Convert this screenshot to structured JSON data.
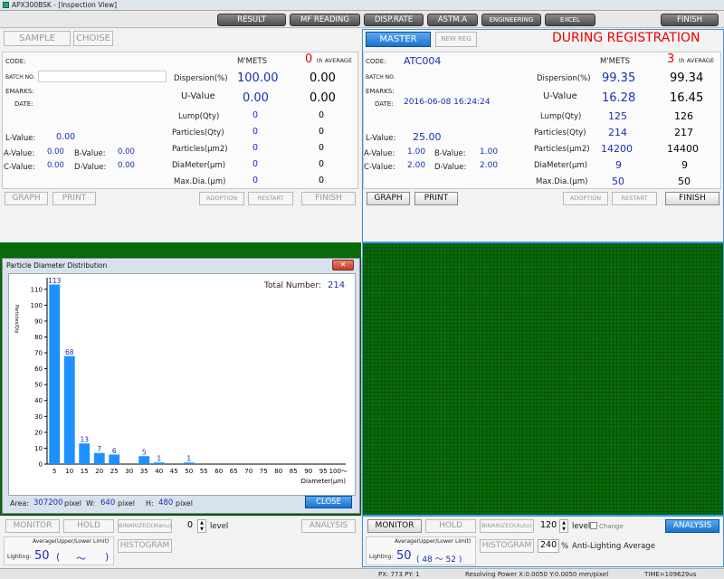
{
  "window": {
    "title": "APX300BSK - [Inspection View]"
  },
  "menu": [
    "RESULT",
    "MF READING",
    "DISP.RATE",
    "ASTM.A",
    "ENGINEERING",
    "EXCEL",
    "FINISH"
  ],
  "left": {
    "sample_label": "SAMPLE",
    "choise_label": "CHOISE",
    "code_label": "CODE:",
    "batch_label": "BATCH NO.",
    "remarks_label": "EMARKS:",
    "date_label": "DATE:",
    "mmets_label": "M'METS",
    "th_count": "0",
    "th_label": "th AVERAGE",
    "rows": [
      {
        "label": "Dispersion(%)",
        "m": "100.00",
        "avg": "0.00"
      },
      {
        "label": "U-Value",
        "m": "0.00",
        "avg": "0.00"
      },
      {
        "label": "Lump(Qty)",
        "m": "0",
        "avg": "0"
      },
      {
        "label": "Particles(Qty)",
        "m": "0",
        "avg": "0"
      },
      {
        "label": "Particles(μm2)",
        "m": "0",
        "avg": "0"
      },
      {
        "label": "DiaMeter(μm)",
        "m": "0",
        "avg": "0"
      },
      {
        "label": "Max.Dia.(μm)",
        "m": "0",
        "avg": "0"
      }
    ],
    "l_value_label": "L-Value:",
    "l_value": "0.00",
    "a_label": "A-Value:",
    "a_value": "0.00",
    "b_label": "B-Value:",
    "b_value": "0.00",
    "c_label": "C-Value:",
    "c_value": "0.00",
    "d_label": "D-Value:",
    "d_value": "0.00",
    "graph_label": "GRAPH",
    "print_label": "PRINT",
    "adoption_label": "ADOPTION",
    "restart_label": "RESTART",
    "finish_label": "FINISH",
    "monitor_label": "MONITOR",
    "hold_label": "HOLD",
    "binarized_label": "BINARIZED(Manu)",
    "level_value": "0",
    "level_label": "level",
    "analysis_label": "ANALYSIS",
    "avg_limit_label": "Average(Upper/Lower Limit)",
    "lighting_label": "Lighting:",
    "lighting_value": "50",
    "paren_open": "(",
    "tilde": "～",
    "paren_close": ")",
    "histogram_label": "HISTOGRAM"
  },
  "right": {
    "master_label": "MASTER",
    "newreg_label": "NEW REG",
    "registration_status": "DURING REGISTRATION",
    "code_label": "CODE:",
    "code_value": "ATC004",
    "batch_label": "BATCH NO.",
    "remarks_label": "EMARKS:",
    "date_label": "DATE:",
    "date_value": "2016-06-08 16:24:24",
    "mmets_label": "M'METS",
    "th_count": "3",
    "th_label": "th AVERAGE",
    "rows": [
      {
        "label": "Dispersion(%)",
        "m": "99.35",
        "avg": "99.34"
      },
      {
        "label": "U-Value",
        "m": "16.28",
        "avg": "16.45"
      },
      {
        "label": "Lump(Qty)",
        "m": "125",
        "avg": "126"
      },
      {
        "label": "Particles(Qty)",
        "m": "214",
        "avg": "217"
      },
      {
        "label": "Particles(μm2)",
        "m": "14200",
        "avg": "14400"
      },
      {
        "label": "DiaMeter(μm)",
        "m": "9",
        "avg": "9"
      },
      {
        "label": "Max.Dia.(μm)",
        "m": "50",
        "avg": "50"
      }
    ],
    "l_value_label": "L-Value:",
    "l_value": "25.00",
    "a_label": "A-Value:",
    "a_value": "1.00",
    "b_label": "B-Value:",
    "b_value": "1.00",
    "c_label": "C-Value:",
    "c_value": "2.00",
    "d_label": "D-Value:",
    "d_value": "2.00",
    "graph_label": "GRAPH",
    "print_label": "PRINT",
    "adoption_label": "ADOPTION",
    "restart_label": "RESTART",
    "finish_label": "FINISH",
    "monitor_label": "MONITOR",
    "hold_label": "HOLD",
    "binarized_label": "BINARIZED(Auto)",
    "level_value": "120",
    "level_label": "level",
    "change_label": "Change",
    "analysis_label": "ANALYSIS",
    "avg_limit_label": "Average(Upper/Lower Limit)",
    "lighting_label": "Lighting:",
    "lighting_value": "50",
    "lighting_range": "( 48 ～ 52 )",
    "histogram_label": "HISTOGRAM",
    "anti_value": "240",
    "anti_unit": "%",
    "anti_label": "Anti-Lighting Average"
  },
  "dialog": {
    "title": "Particle Diameter Distribution",
    "close_label": "CLOSE",
    "total_label": "Total Number:",
    "total_value": "214",
    "area_label": "Area:",
    "area_value": "307200",
    "w_label": "W:",
    "w_value": "640",
    "h_label": "H:",
    "h_value": "480",
    "pixel_unit": "pixel"
  },
  "chart_data": {
    "type": "bar",
    "categories": [
      "5",
      "10",
      "15",
      "20",
      "25",
      "30",
      "35",
      "40",
      "45",
      "50",
      "55",
      "60",
      "65",
      "70",
      "75",
      "80",
      "85",
      "90",
      "95",
      "100〜"
    ],
    "values": [
      113,
      68,
      13,
      7,
      6,
      0,
      5,
      1,
      0,
      1,
      0,
      0,
      0,
      0,
      0,
      0,
      0,
      0,
      0,
      0
    ],
    "xlabel": "Diameter(μm)",
    "ylabel": "Particles/Qty",
    "yticks": [
      "0",
      "10",
      "20",
      "30",
      "40",
      "50",
      "60",
      "70",
      "80",
      "90",
      "100",
      "110"
    ],
    "ylim": [
      0,
      115
    ]
  },
  "status": {
    "px_label": "PX: 773 PY: 1",
    "resolving": "Resolving Power X:0.0050 Y:0.0050 mm/pixel",
    "time": "TIME=109629us"
  }
}
